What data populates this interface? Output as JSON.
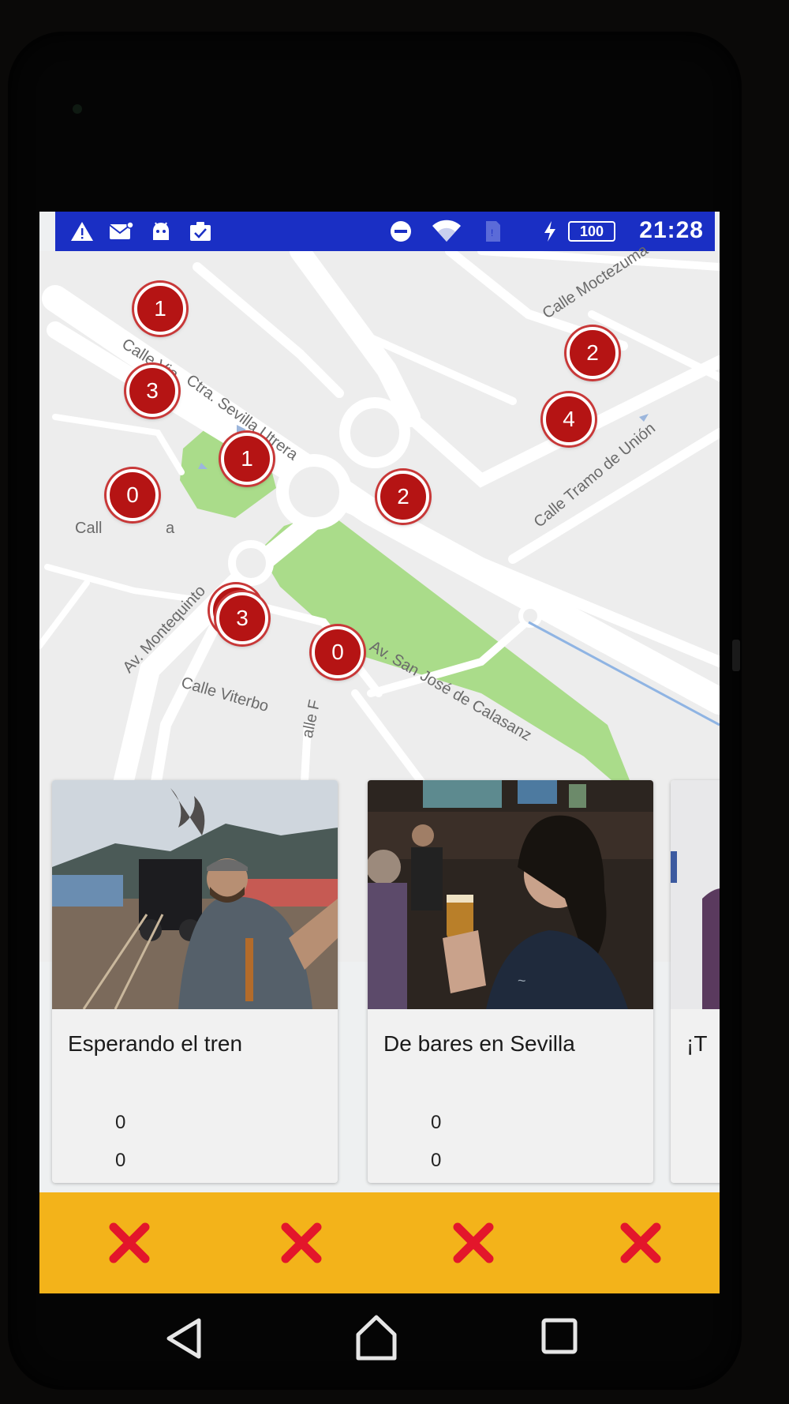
{
  "status_bar": {
    "time": "21:28",
    "battery": "100",
    "icons": [
      "warning-icon",
      "mail-icon",
      "android-icon",
      "clipboard-check-icon",
      "do-not-disturb-icon",
      "wifi-icon",
      "sim-icon",
      "charging-icon"
    ]
  },
  "map": {
    "streets": {
      "moctezuma": "Calle Moctezuma",
      "sevilla_utrera": "Ctra. Sevilla Utrera",
      "via": "Calle Via",
      "tramo_union": "Calle Tramo de Unión",
      "cal": "Call",
      "cal_suffix": "a",
      "montequinto": "Av. Montequinto",
      "viterbo": "Calle Viterbo",
      "san_jose": "Av. San José de Calasanz",
      "alle_f": "alle F"
    },
    "markers": [
      {
        "count": "1"
      },
      {
        "count": "3"
      },
      {
        "count": "1"
      },
      {
        "count": "0"
      },
      {
        "count": "2"
      },
      {
        "count": "2"
      },
      {
        "count": "4"
      },
      {
        "count": "3"
      },
      {
        "count": "0"
      }
    ]
  },
  "cards": [
    {
      "title": "Esperando el tren",
      "count_a": "0",
      "count_b": "0"
    },
    {
      "title": "De bares en Sevilla",
      "count_a": "0",
      "count_b": "0"
    },
    {
      "title": "¡T"
    }
  ],
  "toolbar": {
    "buttons": [
      "close-icon",
      "close-icon",
      "close-icon",
      "close-icon"
    ],
    "icon_color": "#e3162b",
    "background": "#f3b31a"
  },
  "navigation": {
    "buttons": [
      "back-icon",
      "home-icon",
      "recents-icon"
    ]
  },
  "colors": {
    "status_bar": "#1a2fc4",
    "marker": "#b51414",
    "park": "#aadc8a"
  }
}
